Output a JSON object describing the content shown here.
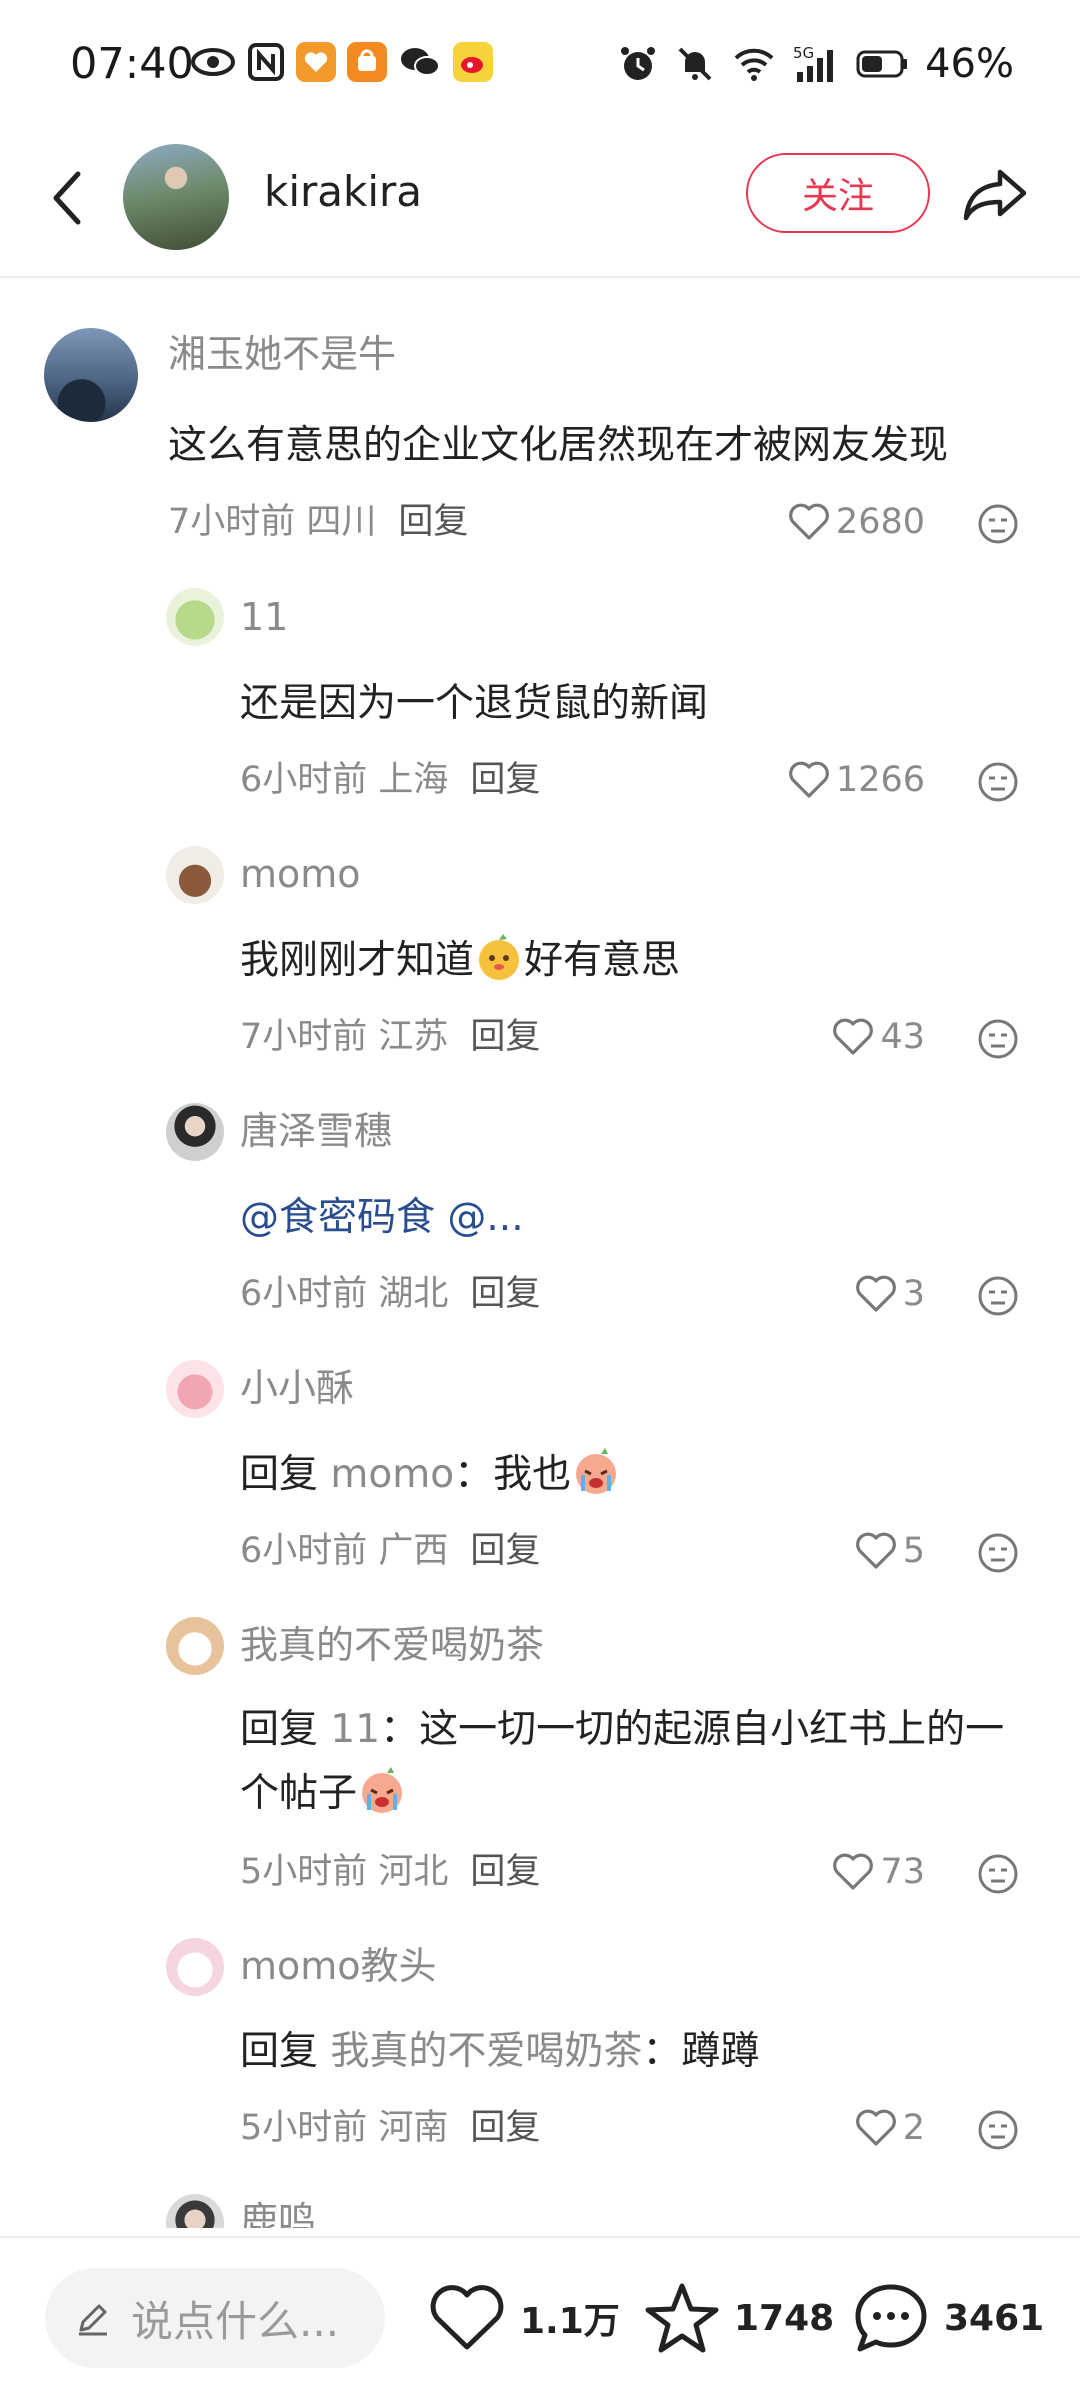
{
  "status_bar": {
    "time": "07:40",
    "battery": "46%",
    "network": "5G"
  },
  "header": {
    "author_name": "kirakira",
    "follow_label": "关注"
  },
  "comments": [
    {
      "name": "湘玉她不是牛",
      "text": "这么有意思的企业文化居然现在才被网友发现",
      "time_location": "7小时前 四川",
      "reply_label": "回复",
      "likes": "2680"
    },
    {
      "name": "11",
      "text": "还是因为一个退货鼠的新闻",
      "time_location": "6小时前 上海",
      "reply_label": "回复",
      "likes": "1266"
    },
    {
      "name": "momo",
      "text_before": "我刚刚才知道",
      "text_after": "好有意思",
      "time_location": "7小时前 江苏",
      "reply_label": "回复",
      "likes": "43"
    },
    {
      "name": "唐泽雪穗",
      "text": "@食密码食  @...",
      "time_location": "6小时前 湖北",
      "reply_label": "回复",
      "likes": "3"
    },
    {
      "name": "小小酥",
      "reply_prefix": "回复",
      "reply_target": "momo",
      "reply_colon": "：",
      "text": "我也",
      "time_location": "6小时前 广西",
      "reply_label": "回复",
      "likes": "5"
    },
    {
      "name": "我真的不爱喝奶茶",
      "reply_prefix": "回复",
      "reply_target": "11",
      "reply_colon": "：",
      "text": "这一切一切的起源自小红书上的一个帖子",
      "time_location": "5小时前 河北",
      "reply_label": "回复",
      "likes": "73"
    },
    {
      "name": "momo教头",
      "reply_prefix": "回复",
      "reply_target": "我真的不爱喝奶茶",
      "reply_colon": "：",
      "text": "蹲蹲",
      "time_location": "5小时前 河南",
      "reply_label": "回复",
      "likes": "2"
    },
    {
      "name": "鹿鸣"
    }
  ],
  "bottom_bar": {
    "input_placeholder": "说点什么...",
    "likes": "1.1万",
    "collects": "1748",
    "comments": "3461"
  },
  "colors": {
    "accent": "#e8384f",
    "mention": "#2a4d8f",
    "muted_text": "#8a8a8a"
  }
}
